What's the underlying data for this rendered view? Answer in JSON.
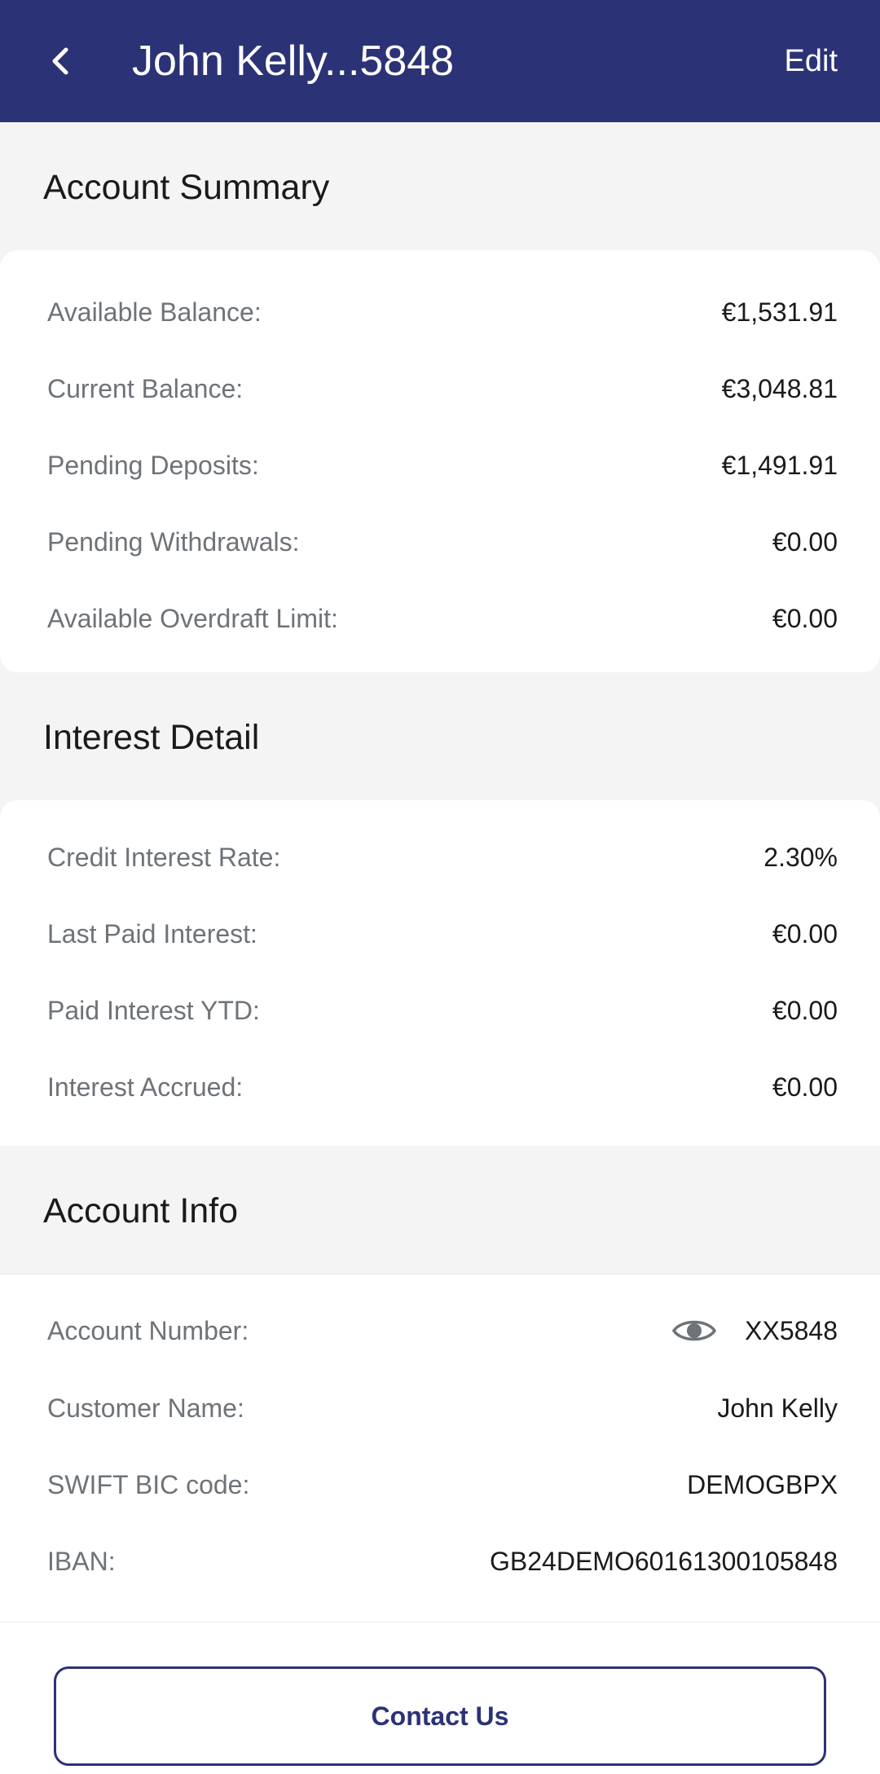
{
  "header": {
    "title": "John Kelly...5848",
    "edit_label": "Edit",
    "background": "#2c3276"
  },
  "account_summary": {
    "title": "Account Summary",
    "rows": [
      {
        "label": "Available Balance:",
        "value": "€1,531.91"
      },
      {
        "label": "Current Balance:",
        "value": "€3,048.81"
      },
      {
        "label": "Pending Deposits:",
        "value": "€1,491.91"
      },
      {
        "label": "Pending Withdrawals:",
        "value": "€0.00"
      },
      {
        "label": "Available Overdraft Limit:",
        "value": "€0.00"
      }
    ]
  },
  "interest_detail": {
    "title": "Interest Detail",
    "rows": [
      {
        "label": "Credit Interest Rate:",
        "value": "2.30%"
      },
      {
        "label": "Last Paid Interest:",
        "value": "€0.00"
      },
      {
        "label": "Paid Interest YTD:",
        "value": "€0.00"
      },
      {
        "label": "Interest Accrued:",
        "value": "€0.00"
      }
    ]
  },
  "account_info": {
    "title": "Account Info",
    "rows": [
      {
        "label": "Account Number:",
        "value": "XX5848",
        "icon": "eye-icon"
      },
      {
        "label": "Customer Name:",
        "value": "John Kelly"
      },
      {
        "label": "SWIFT BIC code:",
        "value": "DEMOGBPX"
      },
      {
        "label": "IBAN:",
        "value": "GB24DEMO60161300105848"
      }
    ]
  },
  "footer": {
    "contact_label": "Contact Us"
  }
}
